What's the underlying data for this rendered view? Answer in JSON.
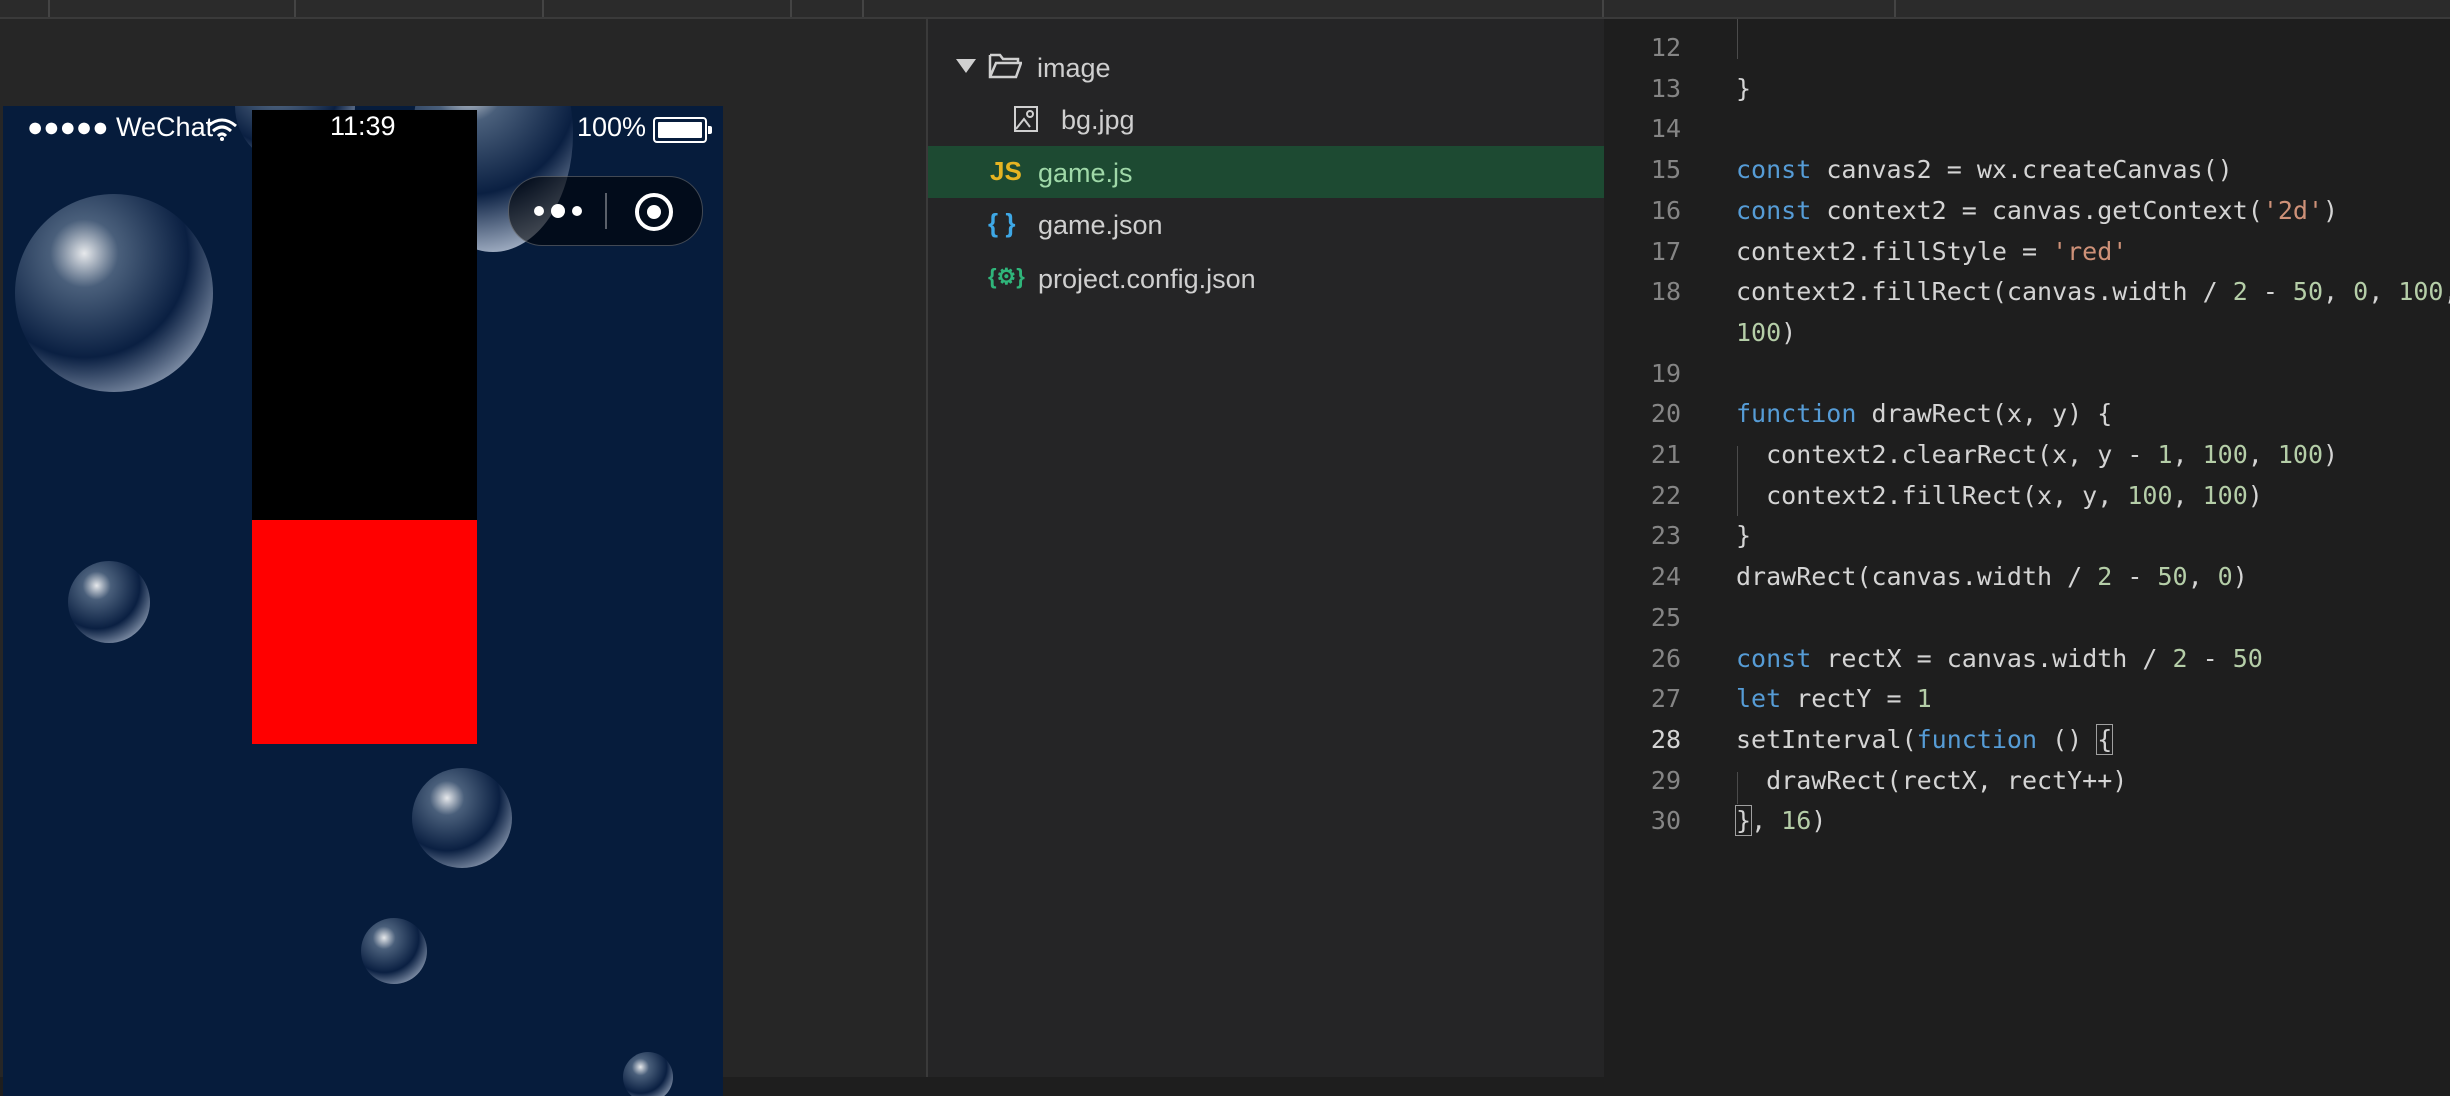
{
  "simulator": {
    "status": {
      "carrier": "●●●●● WeChat",
      "time": "11:39",
      "battery_pct": "100%"
    },
    "capsule": {
      "menu_icon": "more-dots-icon",
      "close_icon": "target-icon"
    },
    "canvas": {
      "fill_color": "#ff0000",
      "background": "#000000"
    }
  },
  "file_tree": {
    "folder": {
      "name": "image"
    },
    "items": [
      {
        "name": "bg.jpg",
        "icon": "image-file-icon"
      },
      {
        "name": "game.js",
        "icon_text": "JS",
        "active": true
      },
      {
        "name": "game.json",
        "icon_text": "{ }"
      },
      {
        "name": "project.config.json",
        "icon_text": "{⚙}"
      }
    ]
  },
  "editor": {
    "current_line": "28",
    "lines": [
      {
        "n": "12",
        "tokens": []
      },
      {
        "n": "13",
        "tokens": [
          [
            "plain",
            "}"
          ]
        ]
      },
      {
        "n": "14",
        "tokens": []
      },
      {
        "n": "15",
        "tokens": [
          [
            "kw",
            "const"
          ],
          [
            "plain",
            " canvas2 = wx.createCanvas()"
          ]
        ]
      },
      {
        "n": "16",
        "tokens": [
          [
            "kw",
            "const"
          ],
          [
            "plain",
            " context2 = canvas.getContext("
          ],
          [
            "str",
            "'2d'"
          ],
          [
            "plain",
            ")"
          ]
        ]
      },
      {
        "n": "17",
        "tokens": [
          [
            "plain",
            "context2.fillStyle = "
          ],
          [
            "str",
            "'red'"
          ]
        ]
      },
      {
        "n": "18",
        "tokens": [
          [
            "plain",
            "context2.fillRect(canvas.width / "
          ],
          [
            "num",
            "2"
          ],
          [
            "plain",
            " - "
          ],
          [
            "num",
            "50"
          ],
          [
            "plain",
            ", "
          ],
          [
            "num",
            "0"
          ],
          [
            "plain",
            ", "
          ],
          [
            "num",
            "100"
          ],
          [
            "plain",
            ","
          ]
        ]
      },
      {
        "n": "",
        "tokens": [
          [
            "num",
            "100"
          ],
          [
            "plain",
            ")"
          ]
        ]
      },
      {
        "n": "19",
        "tokens": []
      },
      {
        "n": "20",
        "tokens": [
          [
            "kw",
            "function"
          ],
          [
            "plain",
            " drawRect(x, y) {"
          ]
        ]
      },
      {
        "n": "21",
        "tokens": [
          [
            "plain",
            "  context2.clearRect(x, y - "
          ],
          [
            "num",
            "1"
          ],
          [
            "plain",
            ", "
          ],
          [
            "num",
            "100"
          ],
          [
            "plain",
            ", "
          ],
          [
            "num",
            "100"
          ],
          [
            "plain",
            ")"
          ]
        ]
      },
      {
        "n": "22",
        "tokens": [
          [
            "plain",
            "  context2.fillRect(x, y, "
          ],
          [
            "num",
            "100"
          ],
          [
            "plain",
            ", "
          ],
          [
            "num",
            "100"
          ],
          [
            "plain",
            ")"
          ]
        ]
      },
      {
        "n": "23",
        "tokens": [
          [
            "plain",
            "}"
          ]
        ]
      },
      {
        "n": "24",
        "tokens": [
          [
            "plain",
            "drawRect(canvas.width / "
          ],
          [
            "num",
            "2"
          ],
          [
            "plain",
            " - "
          ],
          [
            "num",
            "50"
          ],
          [
            "plain",
            ", "
          ],
          [
            "num",
            "0"
          ],
          [
            "plain",
            ")"
          ]
        ]
      },
      {
        "n": "25",
        "tokens": []
      },
      {
        "n": "26",
        "tokens": [
          [
            "kw",
            "const"
          ],
          [
            "plain",
            " rectX = canvas.width / "
          ],
          [
            "num",
            "2"
          ],
          [
            "plain",
            " - "
          ],
          [
            "num",
            "50"
          ]
        ]
      },
      {
        "n": "27",
        "tokens": [
          [
            "kw",
            "let"
          ],
          [
            "plain",
            " rectY = "
          ],
          [
            "num",
            "1"
          ]
        ]
      },
      {
        "n": "28",
        "tokens": [
          [
            "plain",
            "setInterval("
          ],
          [
            "kw",
            "function"
          ],
          [
            "plain",
            " () "
          ],
          [
            "hl",
            "{"
          ]
        ]
      },
      {
        "n": "29",
        "tokens": [
          [
            "plain",
            "  drawRect(rectX, rectY++)"
          ]
        ]
      },
      {
        "n": "30",
        "tokens": [
          [
            "hl",
            "}"
          ],
          [
            "plain",
            ", "
          ],
          [
            "num",
            "16"
          ],
          [
            "plain",
            ")"
          ]
        ]
      }
    ]
  }
}
